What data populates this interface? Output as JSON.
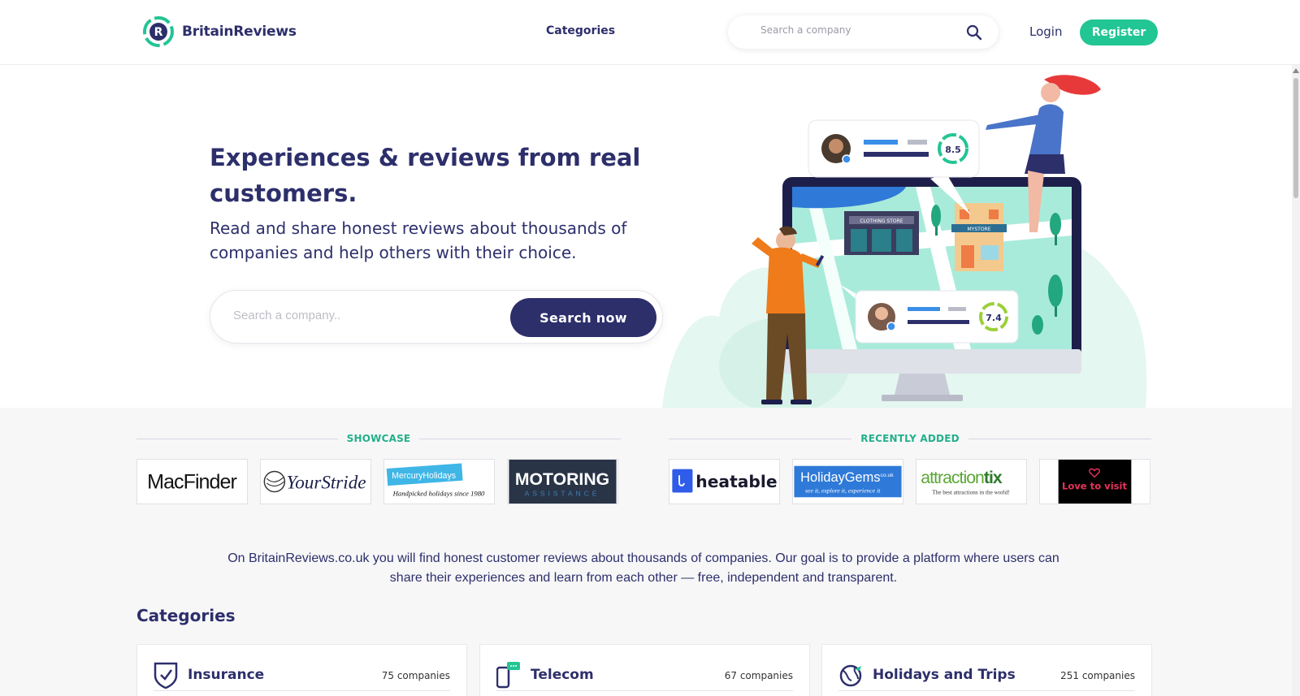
{
  "header": {
    "brand": "BritainReviews",
    "nav_categories": "Categories",
    "search_placeholder": "Search a company",
    "login": "Login",
    "register": "Register"
  },
  "hero": {
    "title": "Experiences & reviews from real customers.",
    "subtitle": "Read and share honest reviews about thousands of companies and help others with their choice.",
    "search_placeholder": "Search a company..",
    "search_button": "Search now",
    "illustration": {
      "store_sign_left": "CLOTHING STORE",
      "store_sign_right": "MYSTORE",
      "score_top": "8.5",
      "score_bottom": "7.4"
    }
  },
  "showcase": {
    "label": "SHOWCASE",
    "logos": [
      {
        "name": "MacFinder",
        "text": "MacFinder"
      },
      {
        "name": "YourStride",
        "text": "YourStride"
      },
      {
        "name": "MercuryHolidays",
        "text": "MercuryHolidays",
        "tagline": "Handpicked holidays since 1980"
      },
      {
        "name": "MotoringAssistance",
        "text": "MOTORING",
        "tagline": "ASSISTANCE"
      }
    ]
  },
  "recently_added": {
    "label": "RECENTLY ADDED",
    "logos": [
      {
        "name": "heatable",
        "text": "heatable"
      },
      {
        "name": "HolidayGems",
        "text": "HolidayGems",
        "suffix": ".co.uk",
        "tagline": "see it, explore it, experience it"
      },
      {
        "name": "attractiontix",
        "text": "attraction",
        "text_bold": "tix",
        "tagline": "The best attractions in the world!"
      },
      {
        "name": "LoveToVisit",
        "text": "Love to visit"
      }
    ]
  },
  "intro": "On BritainReviews.co.uk you will find honest customer reviews about thousands of companies. Our goal is to provide a platform where users can share their experiences and learn from each other — free, independent and transparent.",
  "categories": {
    "title": "Categories",
    "items": [
      {
        "name": "Insurance",
        "count": "75 companies",
        "icon": "shield-check-icon"
      },
      {
        "name": "Telecom",
        "count": "67 companies",
        "icon": "phone-chat-icon"
      },
      {
        "name": "Holidays and Trips",
        "count": "251 companies",
        "icon": "globe-plane-icon"
      }
    ]
  },
  "colors": {
    "navy": "#2d2f6b",
    "green": "#22c594",
    "showcase_label": "#22b08a"
  }
}
